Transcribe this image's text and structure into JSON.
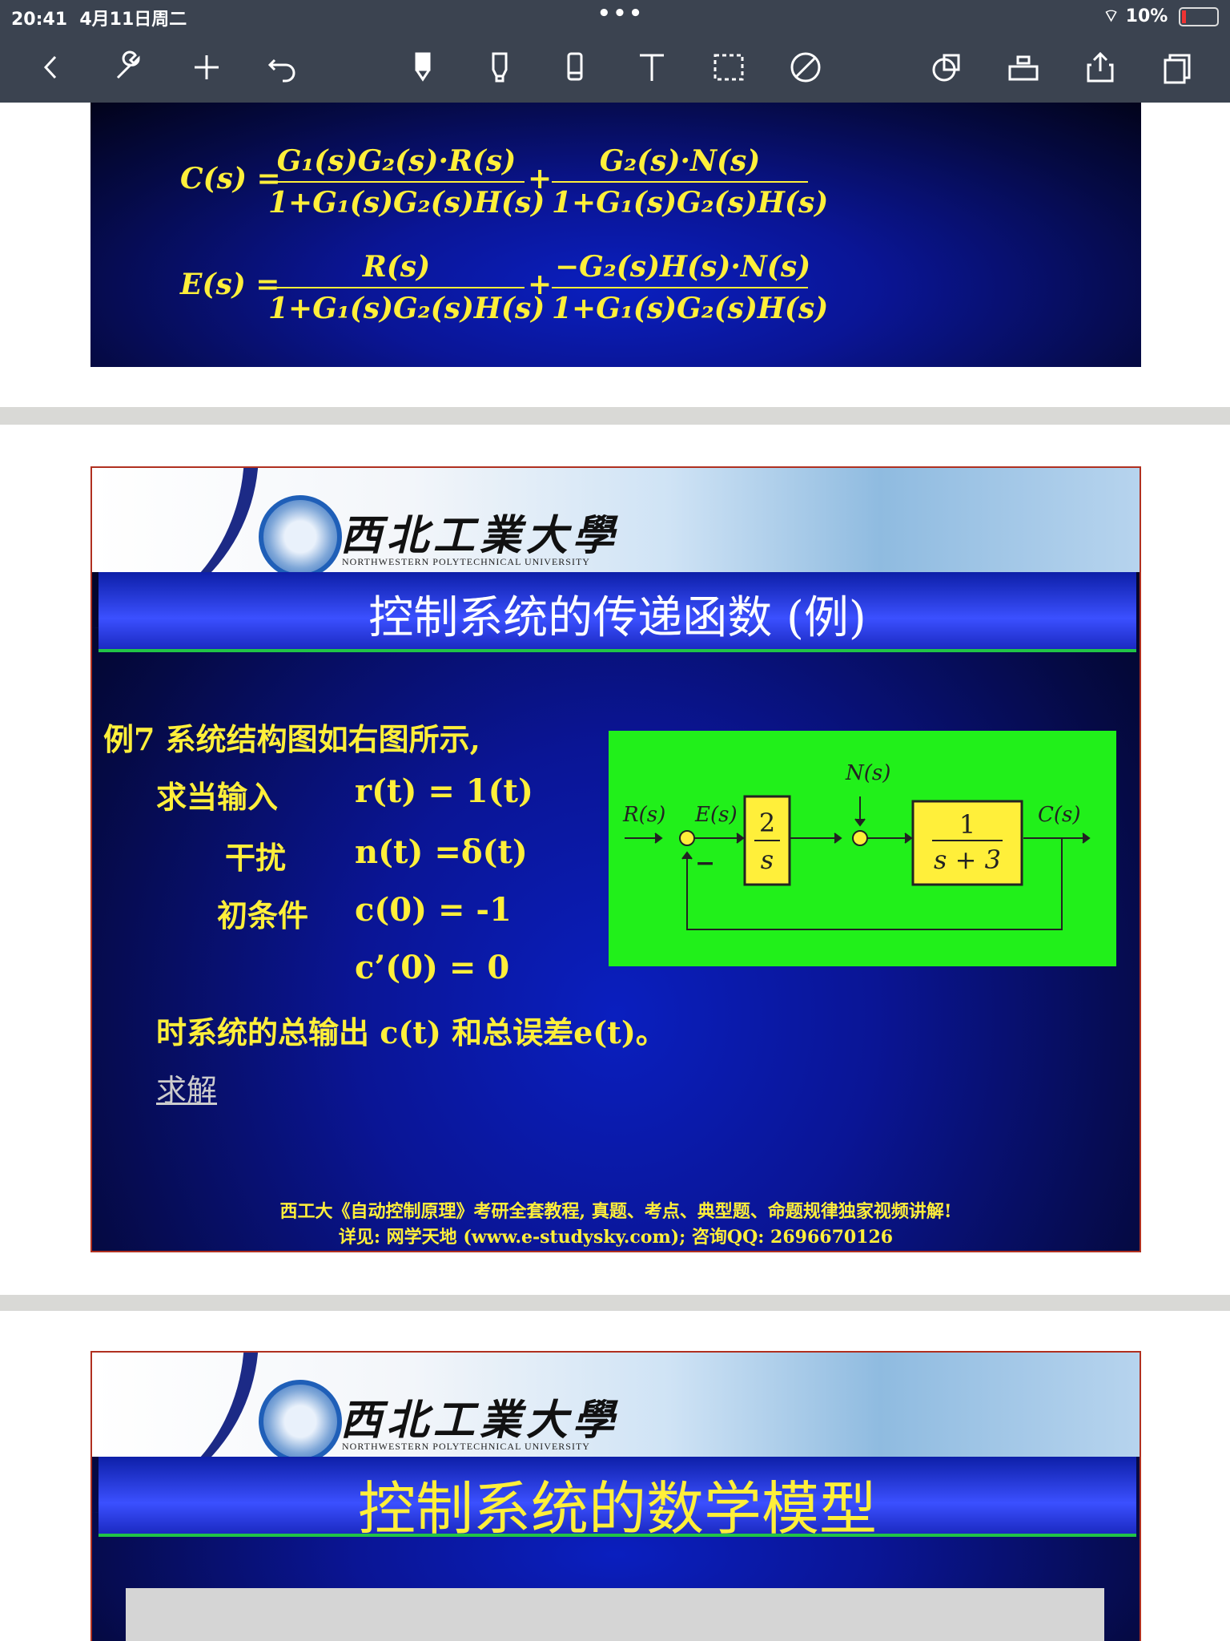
{
  "status": {
    "time": "20:41",
    "date": "4月11日周二",
    "battery": "10%"
  },
  "toolbar": {
    "tools": [
      "back-icon",
      "wrench-icon",
      "plus-icon",
      "undo-icon",
      "pen-icon",
      "highlighter-icon",
      "eraser-icon",
      "text-icon",
      "lasso-icon",
      "no-touch-icon",
      "shapes-icon",
      "elements-icon",
      "share-icon",
      "pages-icon"
    ]
  },
  "slide1": {
    "eq1": {
      "lhs": "C(s) =",
      "num1": "G₁(s)G₂(s)·R(s)",
      "den1": "1+G₁(s)G₂(s)H(s)",
      "plus": "+",
      "num2": "G₂(s)·N(s)",
      "den2": "1+G₁(s)G₂(s)H(s)"
    },
    "eq2": {
      "lhs": "E(s) =",
      "num1": "R(s)",
      "den1": "1+G₁(s)G₂(s)H(s)",
      "plus": "+",
      "num2": "−G₂(s)H(s)·N(s)",
      "den2": "1+G₁(s)G₂(s)H(s)"
    }
  },
  "slide2": {
    "university": "西北工業大學",
    "university_en": "NORTHWESTERN POLYTECHNICAL UNIVERSITY",
    "title": "控制系统的传递函数 (例)",
    "problem": {
      "line1": "例7 系统结构图如右图所示,",
      "row1_label": "求当输入",
      "row1_value": "r(t) = 1(t)",
      "row2_label": "干扰",
      "row2_value": "n(t) =δ(t)",
      "row3_label": "初条件",
      "row3_value": "c(0) = -1",
      "row4_value": "c’(0) = 0",
      "line_end": "时系统的总输出 c(t) 和总误差e(t)。",
      "solve_link": "求解"
    },
    "diagram": {
      "R": "R(s)",
      "E": "E(s)",
      "N": "N(s)",
      "C": "C(s)",
      "block1_num": "2",
      "block1_den": "s",
      "block2_num": "1",
      "block2_den": "s + 3",
      "minus": "−"
    },
    "footer_line1": "西工大《自动控制原理》考研全套教程, 真题、考点、典型题、命题规律独家视频讲解!",
    "footer_line2": "详见: 网学天地 (www.e-studysky.com); 咨询QQ: 2696670126"
  },
  "slide3": {
    "university": "西北工業大學",
    "university_en": "NORTHWESTERN POLYTECHNICAL UNIVERSITY",
    "title": "控制系统的数学模型"
  }
}
